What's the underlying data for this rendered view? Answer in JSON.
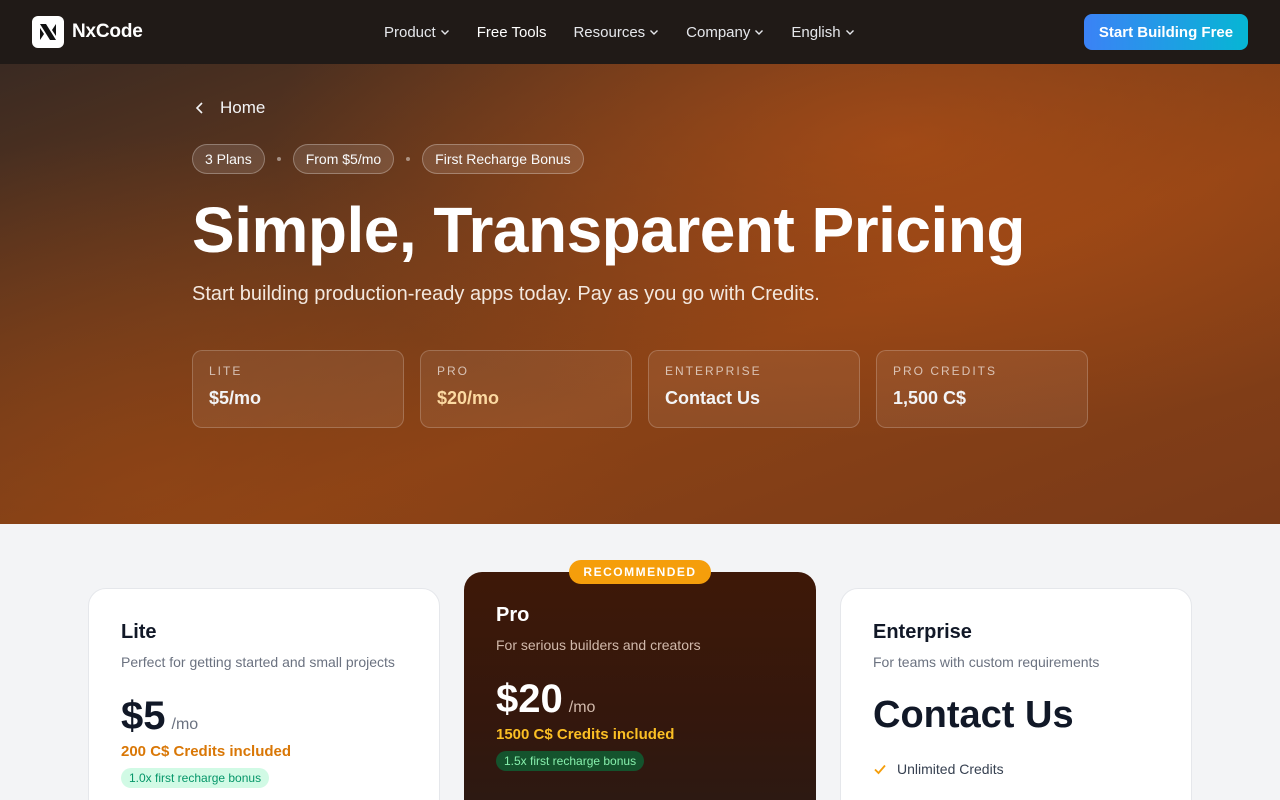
{
  "nav": {
    "brand": "NxCode",
    "items": [
      {
        "label": "Product",
        "dropdown": true
      },
      {
        "label": "Free Tools",
        "dropdown": false
      },
      {
        "label": "Resources",
        "dropdown": true
      },
      {
        "label": "Company",
        "dropdown": true
      },
      {
        "label": "English",
        "dropdown": true
      }
    ],
    "cta": "Start Building Free"
  },
  "hero": {
    "back_label": "Home",
    "pills": [
      "3 Plans",
      "From $5/mo",
      "First Recharge Bonus"
    ],
    "title": "Simple, Transparent Pricing",
    "subtitle": "Start building production-ready apps today. Pay as you go with Credits.",
    "stats": [
      {
        "label": "LITE",
        "value": "$5/mo"
      },
      {
        "label": "PRO",
        "value": "$20/mo"
      },
      {
        "label": "ENTERPRISE",
        "value": "Contact Us"
      },
      {
        "label": "PRO CREDITS",
        "value": "1,500 C$"
      }
    ]
  },
  "plans": {
    "lite": {
      "name": "Lite",
      "desc": "Perfect for getting started and small projects",
      "price": "$5",
      "period": "/mo",
      "credits": "200 C$ Credits included",
      "bonus": "1.0x first recharge bonus"
    },
    "pro": {
      "badge": "RECOMMENDED",
      "name": "Pro",
      "desc": "For serious builders and creators",
      "price": "$20",
      "period": "/mo",
      "credits": "1500 C$ Credits included",
      "bonus": "1.5x first recharge bonus"
    },
    "enterprise": {
      "name": "Enterprise",
      "desc": "For teams with custom requirements",
      "price": "Contact Us",
      "feature": "Unlimited Credits"
    }
  },
  "colors": {
    "cta_gradient_start": "#3b82f6",
    "cta_gradient_end": "#06b6d4",
    "badge": "#f59e0b",
    "credits_accent": "#d97706"
  }
}
